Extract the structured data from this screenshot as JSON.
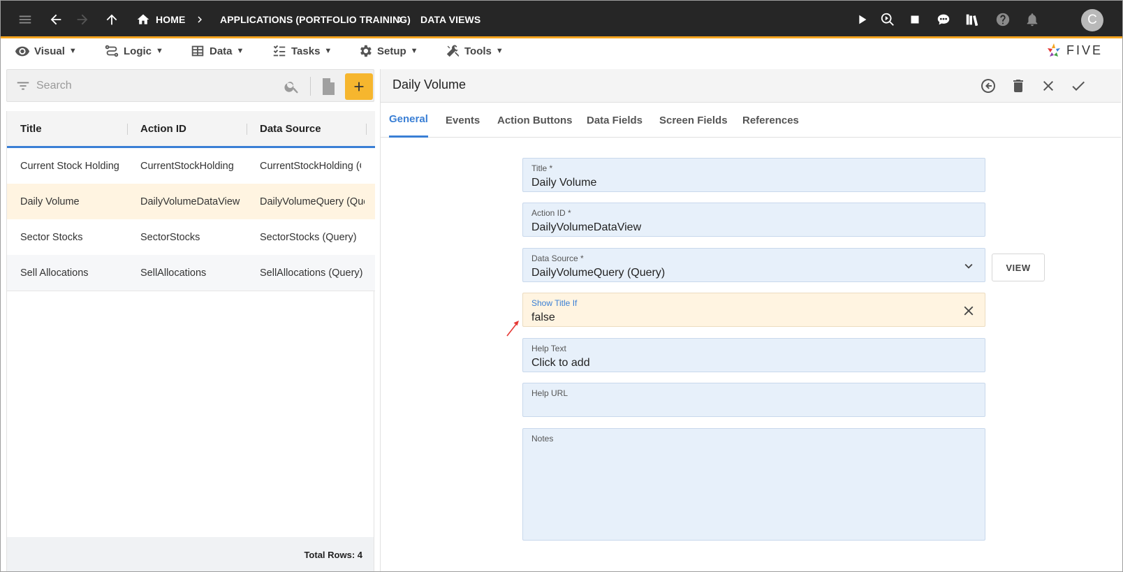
{
  "topbar": {
    "crumbs": [
      "HOME",
      "APPLICATIONS (PORTFOLIO TRAINING)",
      "DATA VIEWS"
    ],
    "avatar_initial": "C"
  },
  "menu": {
    "items": [
      {
        "label": "Visual",
        "icon": "eye-icon"
      },
      {
        "label": "Logic",
        "icon": "logic-icon"
      },
      {
        "label": "Data",
        "icon": "table-icon"
      },
      {
        "label": "Tasks",
        "icon": "checklist-icon"
      },
      {
        "label": "Setup",
        "icon": "gear-icon"
      },
      {
        "label": "Tools",
        "icon": "tools-icon"
      }
    ],
    "caret": "▼",
    "logo_text": "FIVE"
  },
  "search": {
    "placeholder": "Search"
  },
  "grid": {
    "columns": [
      "Title",
      "Action ID",
      "Data Source"
    ],
    "rows": [
      [
        "Current Stock Holding",
        "CurrentStockHolding",
        "CurrentStockHolding (Query)"
      ],
      [
        "Daily Volume",
        "DailyVolumeDataView",
        "DailyVolumeQuery (Query)"
      ],
      [
        "Sector Stocks",
        "SectorStocks",
        "SectorStocks (Query)"
      ],
      [
        "Sell Allocations",
        "SellAllocations",
        "SellAllocations (Query)"
      ]
    ],
    "selected_row": 1,
    "footer": "Total Rows: 4"
  },
  "form": {
    "title": "Daily Volume",
    "tabs": [
      "General",
      "Events",
      "Action Buttons",
      "Data Fields",
      "Screen Fields",
      "References"
    ],
    "active_tab": "General",
    "fields": {
      "title": {
        "label": "Title *",
        "value": "Daily Volume"
      },
      "action_id": {
        "label": "Action ID *",
        "value": "DailyVolumeDataView"
      },
      "data_source": {
        "label": "Data Source *",
        "value": "DailyVolumeQuery (Query)"
      },
      "show_title_if": {
        "label": "Show Title If",
        "value": "false"
      },
      "help_text": {
        "label": "Help Text",
        "value": "Click to add"
      },
      "help_url": {
        "label": "Help URL",
        "value": ""
      },
      "notes": {
        "label": "Notes",
        "value": ""
      }
    },
    "view_button": "VIEW"
  },
  "colors": {
    "accent": "#3a7fd5",
    "add_button": "#f6b62e",
    "topbar": "#262626",
    "topbar_border": "#f4a420",
    "field_bg": "#e7f0fa",
    "field_warn_bg": "#fff4e1",
    "annotation_arrow": "#e53935"
  }
}
